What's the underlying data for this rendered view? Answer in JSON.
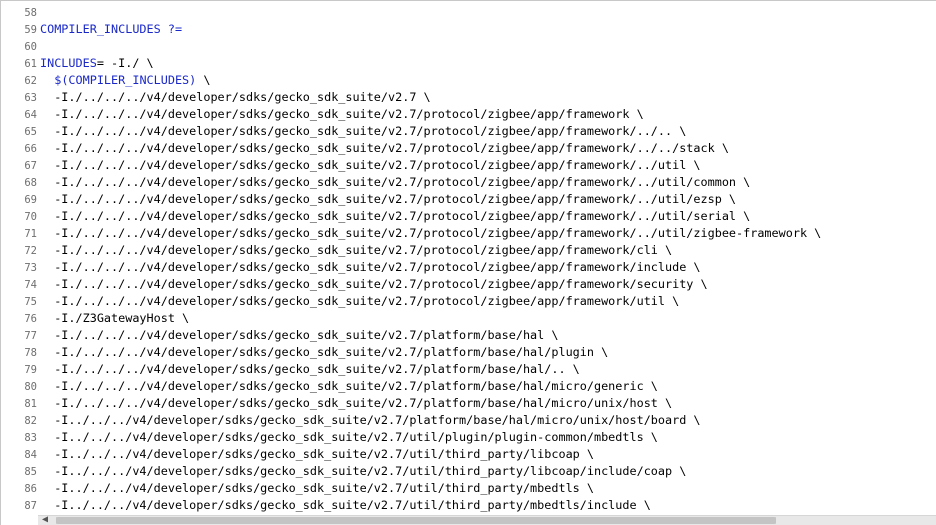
{
  "lines": [
    {
      "n": "58",
      "parts": []
    },
    {
      "n": "59",
      "parts": [
        {
          "t": "COMPILER_INCLUDES",
          "c": "kw"
        },
        {
          "t": " ",
          "c": "op"
        },
        {
          "t": "?=",
          "c": "kw"
        }
      ]
    },
    {
      "n": "60",
      "parts": []
    },
    {
      "n": "61",
      "parts": [
        {
          "t": "INCLUDES",
          "c": "kw"
        },
        {
          "t": "= -I./ \\",
          "c": "op"
        }
      ]
    },
    {
      "n": "62",
      "parts": [
        {
          "t": "  ",
          "c": "op"
        },
        {
          "t": "$(COMPILER_INCLUDES)",
          "c": "kw"
        },
        {
          "t": " \\",
          "c": "op"
        }
      ]
    },
    {
      "n": "63",
      "parts": [
        {
          "t": "  -I./../../../v4/developer/sdks/gecko_sdk_suite/v2.7 \\",
          "c": "op"
        }
      ]
    },
    {
      "n": "64",
      "parts": [
        {
          "t": "  -I./../../../v4/developer/sdks/gecko_sdk_suite/v2.7/protocol/zigbee/app/framework \\",
          "c": "op"
        }
      ]
    },
    {
      "n": "65",
      "parts": [
        {
          "t": "  -I./../../../v4/developer/sdks/gecko_sdk_suite/v2.7/protocol/zigbee/app/framework/../.. \\",
          "c": "op"
        }
      ]
    },
    {
      "n": "66",
      "parts": [
        {
          "t": "  -I./../../../v4/developer/sdks/gecko_sdk_suite/v2.7/protocol/zigbee/app/framework/../../stack \\",
          "c": "op"
        }
      ]
    },
    {
      "n": "67",
      "parts": [
        {
          "t": "  -I./../../../v4/developer/sdks/gecko_sdk_suite/v2.7/protocol/zigbee/app/framework/../util \\",
          "c": "op"
        }
      ]
    },
    {
      "n": "68",
      "parts": [
        {
          "t": "  -I./../../../v4/developer/sdks/gecko_sdk_suite/v2.7/protocol/zigbee/app/framework/../util/common \\",
          "c": "op"
        }
      ]
    },
    {
      "n": "69",
      "parts": [
        {
          "t": "  -I./../../../v4/developer/sdks/gecko_sdk_suite/v2.7/protocol/zigbee/app/framework/../util/ezsp \\",
          "c": "op"
        }
      ]
    },
    {
      "n": "70",
      "parts": [
        {
          "t": "  -I./../../../v4/developer/sdks/gecko_sdk_suite/v2.7/protocol/zigbee/app/framework/../util/serial \\",
          "c": "op"
        }
      ]
    },
    {
      "n": "71",
      "parts": [
        {
          "t": "  -I./../../../v4/developer/sdks/gecko_sdk_suite/v2.7/protocol/zigbee/app/framework/../util/zigbee-framework \\",
          "c": "op"
        }
      ]
    },
    {
      "n": "72",
      "parts": [
        {
          "t": "  -I./../../../v4/developer/sdks/gecko_sdk_suite/v2.7/protocol/zigbee/app/framework/cli \\",
          "c": "op"
        }
      ]
    },
    {
      "n": "73",
      "parts": [
        {
          "t": "  -I./../../../v4/developer/sdks/gecko_sdk_suite/v2.7/protocol/zigbee/app/framework/include \\",
          "c": "op"
        }
      ]
    },
    {
      "n": "74",
      "parts": [
        {
          "t": "  -I./../../../v4/developer/sdks/gecko_sdk_suite/v2.7/protocol/zigbee/app/framework/security \\",
          "c": "op"
        }
      ]
    },
    {
      "n": "75",
      "parts": [
        {
          "t": "  -I./../../../v4/developer/sdks/gecko_sdk_suite/v2.7/protocol/zigbee/app/framework/util \\",
          "c": "op"
        }
      ]
    },
    {
      "n": "76",
      "parts": [
        {
          "t": "  -I./Z3GatewayHost \\",
          "c": "op"
        }
      ]
    },
    {
      "n": "77",
      "parts": [
        {
          "t": "  -I./../../../v4/developer/sdks/gecko_sdk_suite/v2.7/platform/base/hal \\",
          "c": "op"
        }
      ]
    },
    {
      "n": "78",
      "parts": [
        {
          "t": "  -I./../../../v4/developer/sdks/gecko_sdk_suite/v2.7/platform/base/hal/plugin \\",
          "c": "op"
        }
      ]
    },
    {
      "n": "79",
      "parts": [
        {
          "t": "  -I./../../../v4/developer/sdks/gecko_sdk_suite/v2.7/platform/base/hal/.. \\",
          "c": "op"
        }
      ]
    },
    {
      "n": "80",
      "parts": [
        {
          "t": "  -I./../../../v4/developer/sdks/gecko_sdk_suite/v2.7/platform/base/hal/micro/generic \\",
          "c": "op"
        }
      ]
    },
    {
      "n": "81",
      "parts": [
        {
          "t": "  -I./../../../v4/developer/sdks/gecko_sdk_suite/v2.7/platform/base/hal/micro/unix/host \\",
          "c": "op"
        }
      ]
    },
    {
      "n": "82",
      "parts": [
        {
          "t": "  -I../../../v4/developer/sdks/gecko_sdk_suite/v2.7/platform/base/hal/micro/unix/host/board \\",
          "c": "op"
        }
      ]
    },
    {
      "n": "83",
      "parts": [
        {
          "t": "  -I../../../v4/developer/sdks/gecko_sdk_suite/v2.7/util/plugin/plugin-common/mbedtls \\",
          "c": "op"
        }
      ]
    },
    {
      "n": "84",
      "parts": [
        {
          "t": "  -I../../../v4/developer/sdks/gecko_sdk_suite/v2.7/util/third_party/libcoap \\",
          "c": "op"
        }
      ]
    },
    {
      "n": "85",
      "parts": [
        {
          "t": "  -I../../../v4/developer/sdks/gecko_sdk_suite/v2.7/util/third_party/libcoap/include/coap \\",
          "c": "op"
        }
      ]
    },
    {
      "n": "86",
      "parts": [
        {
          "t": "  -I../../../v4/developer/sdks/gecko_sdk_suite/v2.7/util/third_party/mbedtls \\",
          "c": "op"
        }
      ]
    },
    {
      "n": "87",
      "parts": [
        {
          "t": "  -I../../../v4/developer/sdks/gecko_sdk_suite/v2.7/util/third_party/mbedtls/include \\",
          "c": "op"
        }
      ]
    }
  ],
  "scrollbar": {
    "left_arrow": "◀",
    "right_arrow": "▶"
  }
}
